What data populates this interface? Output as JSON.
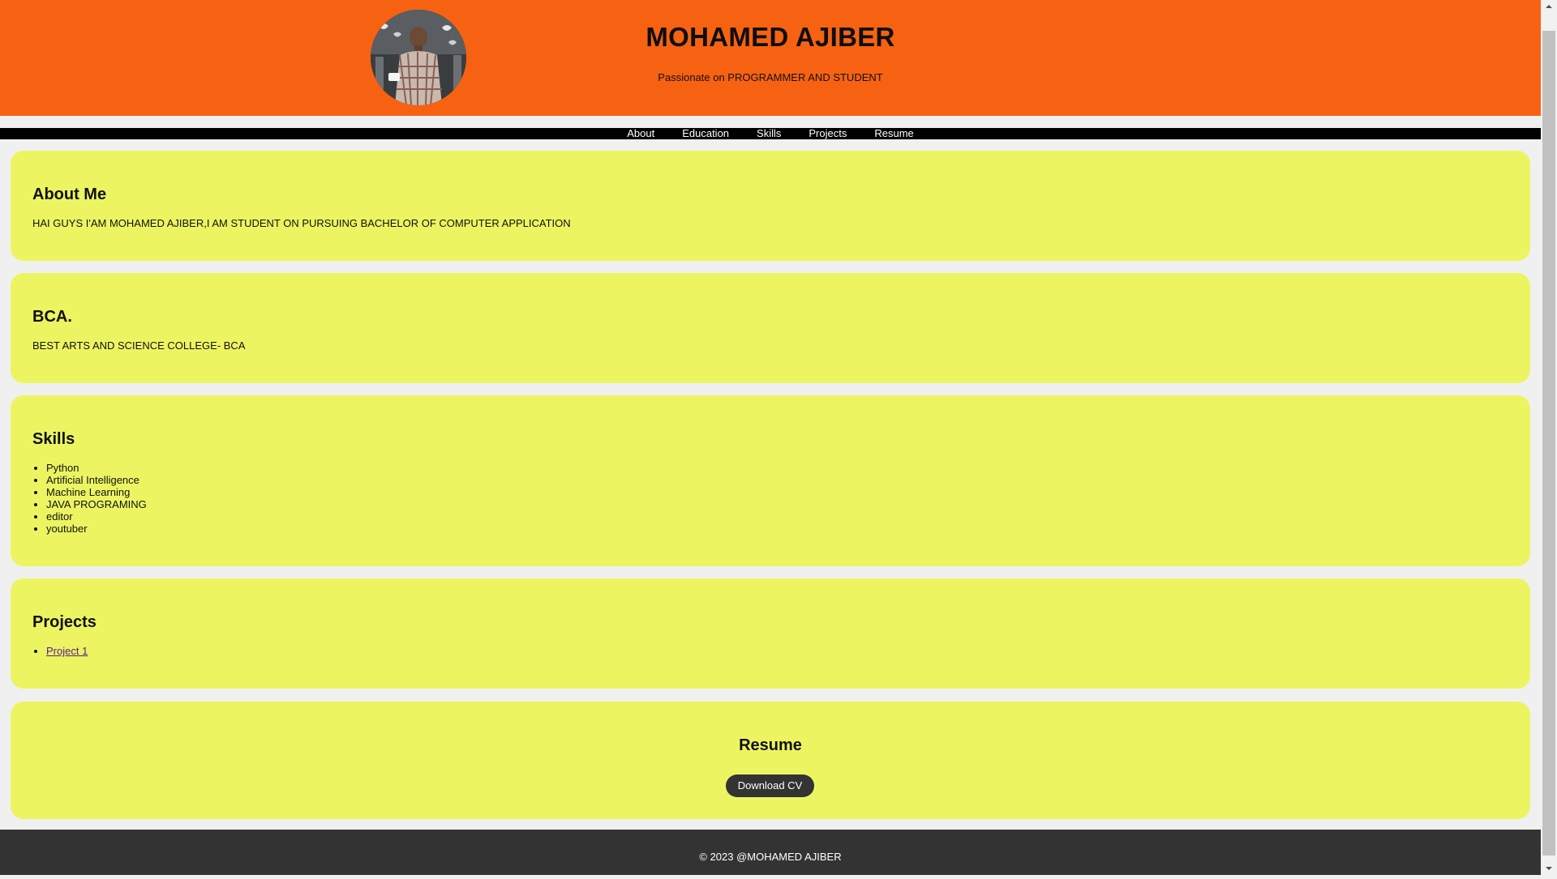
{
  "header": {
    "title": "MOHAMED AJIBER",
    "subtitle": "Passionate on PROGRAMMER AND STUDENT",
    "background_color": "#f76212"
  },
  "nav": {
    "items": [
      {
        "label": "About"
      },
      {
        "label": "Education"
      },
      {
        "label": "Skills"
      },
      {
        "label": "Projects"
      },
      {
        "label": "Resume"
      }
    ]
  },
  "about": {
    "heading": "About Me",
    "text": "HAI GUYS I'AM MOHAMED AJIBER,I AM STUDENT ON PURSUING BACHELOR OF COMPUTER APPLICATION"
  },
  "education": {
    "heading": "BCA.",
    "text": "BEST ARTS AND SCIENCE COLLEGE- BCA"
  },
  "skills": {
    "heading": "Skills",
    "items": [
      "Python",
      "Artificial Intelligence",
      "Machine Learning",
      "JAVA PROGRAMING",
      "editor",
      "youtuber"
    ]
  },
  "projects": {
    "heading": "Projects",
    "items": [
      "Project 1"
    ]
  },
  "resume": {
    "heading": "Resume",
    "button_label": "Download CV"
  },
  "footer": {
    "text": "© 2023 @MOHAMED AJIBER"
  },
  "colors": {
    "section_bg": "#ecf561",
    "footer_bg": "#333333",
    "nav_bg": "#000000"
  }
}
